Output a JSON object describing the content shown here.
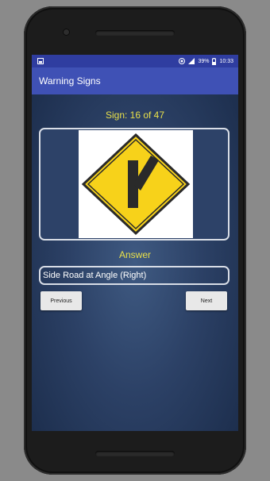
{
  "status_bar": {
    "battery_percent": "39%",
    "time": "10:33"
  },
  "app_bar": {
    "title": "Warning Signs"
  },
  "quiz": {
    "counter": "Sign: 16 of 47",
    "sign_icon": "side-road-angle-right-sign",
    "answer_label": "Answer",
    "answer_text": "Side Road at Angle (Right)"
  },
  "buttons": {
    "previous": "Previous",
    "next": "Next"
  },
  "colors": {
    "status_bar": "#2f3da0",
    "app_bar": "#3f51b5",
    "accent_text": "#e8e04a",
    "sign_yellow": "#f7d21a"
  }
}
